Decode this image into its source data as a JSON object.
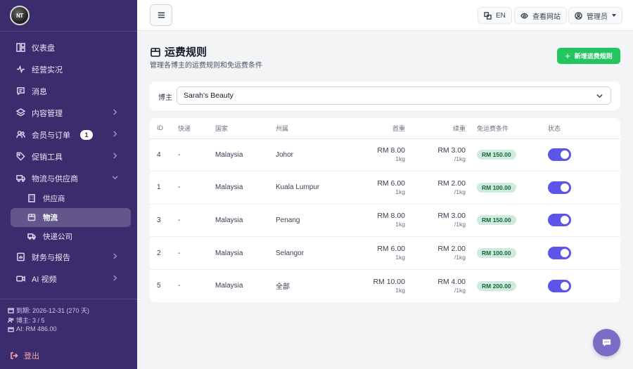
{
  "brand": {
    "logo_text": "NT"
  },
  "sidebar": {
    "items": [
      {
        "label": "仪表盘",
        "icon": "dashboard-icon",
        "has_chevron": false
      },
      {
        "label": "经营实况",
        "icon": "activity-icon",
        "has_chevron": false
      },
      {
        "label": "消息",
        "icon": "message-icon",
        "has_chevron": false
      },
      {
        "label": "内容管理",
        "icon": "layers-icon",
        "has_chevron": true
      },
      {
        "label": "会员与订单",
        "icon": "users-icon",
        "has_chevron": true,
        "badge": "1"
      },
      {
        "label": "促销工具",
        "icon": "tag-icon",
        "has_chevron": true
      },
      {
        "label": "物流与供应商",
        "icon": "truck-icon",
        "has_chevron": true,
        "expanded": true
      }
    ],
    "sub_items": [
      {
        "label": "供应商",
        "icon": "building-icon",
        "active": false
      },
      {
        "label": "物流",
        "icon": "box-icon",
        "active": true
      },
      {
        "label": "快递公司",
        "icon": "truck-icon",
        "active": false
      }
    ],
    "items_after": [
      {
        "label": "财务与报告",
        "icon": "report-icon",
        "has_chevron": true
      },
      {
        "label": "AI 视频",
        "icon": "video-icon",
        "has_chevron": true
      }
    ],
    "info": {
      "expiry": "到期: 2026-12-31 (270 天)",
      "bloggers": "博主: 3 / 5",
      "ai": "AI: RM 486.00"
    },
    "logout": "登出"
  },
  "topbar": {
    "lang": "EN",
    "view_site": "查看网站",
    "admin": "管理员"
  },
  "page": {
    "title": "运费规则",
    "subtitle": "管理各博主的运费规则和免运费条件",
    "add_button": "新增运费规则"
  },
  "filter": {
    "label": "博主",
    "selected": "Sarah's Beauty"
  },
  "table": {
    "headers": [
      "ID",
      "快递",
      "国家",
      "州属",
      "首重",
      "续重",
      "免运费条件",
      "状态"
    ],
    "rows": [
      {
        "id": "4",
        "express": "-",
        "country": "Malaysia",
        "state": "Johor",
        "first": "RM 8.00",
        "first_unit": "1kg",
        "cont": "RM 3.00",
        "cont_unit": "/1kg",
        "free": "RM 150.00",
        "enabled": true
      },
      {
        "id": "1",
        "express": "-",
        "country": "Malaysia",
        "state": "Kuala Lumpur",
        "first": "RM 6.00",
        "first_unit": "1kg",
        "cont": "RM 2.00",
        "cont_unit": "/1kg",
        "free": "RM 100.00",
        "enabled": true
      },
      {
        "id": "3",
        "express": "-",
        "country": "Malaysia",
        "state": "Penang",
        "first": "RM 8.00",
        "first_unit": "1kg",
        "cont": "RM 3.00",
        "cont_unit": "/1kg",
        "free": "RM 150.00",
        "enabled": true
      },
      {
        "id": "2",
        "express": "-",
        "country": "Malaysia",
        "state": "Selangor",
        "first": "RM 6.00",
        "first_unit": "1kg",
        "cont": "RM 2.00",
        "cont_unit": "/1kg",
        "free": "RM 100.00",
        "enabled": true
      },
      {
        "id": "5",
        "express": "-",
        "country": "Malaysia",
        "state": "全部",
        "first": "RM 10.00",
        "first_unit": "1kg",
        "cont": "RM 4.00",
        "cont_unit": "/1kg",
        "free": "RM 200.00",
        "enabled": true
      }
    ]
  },
  "colors": {
    "sidebar_bg": "#3b2c6e",
    "accent": "#5b55e8",
    "add_button": "#22c55e",
    "badge_free": "#cfeade",
    "chat_fab": "#7c6cc4"
  }
}
